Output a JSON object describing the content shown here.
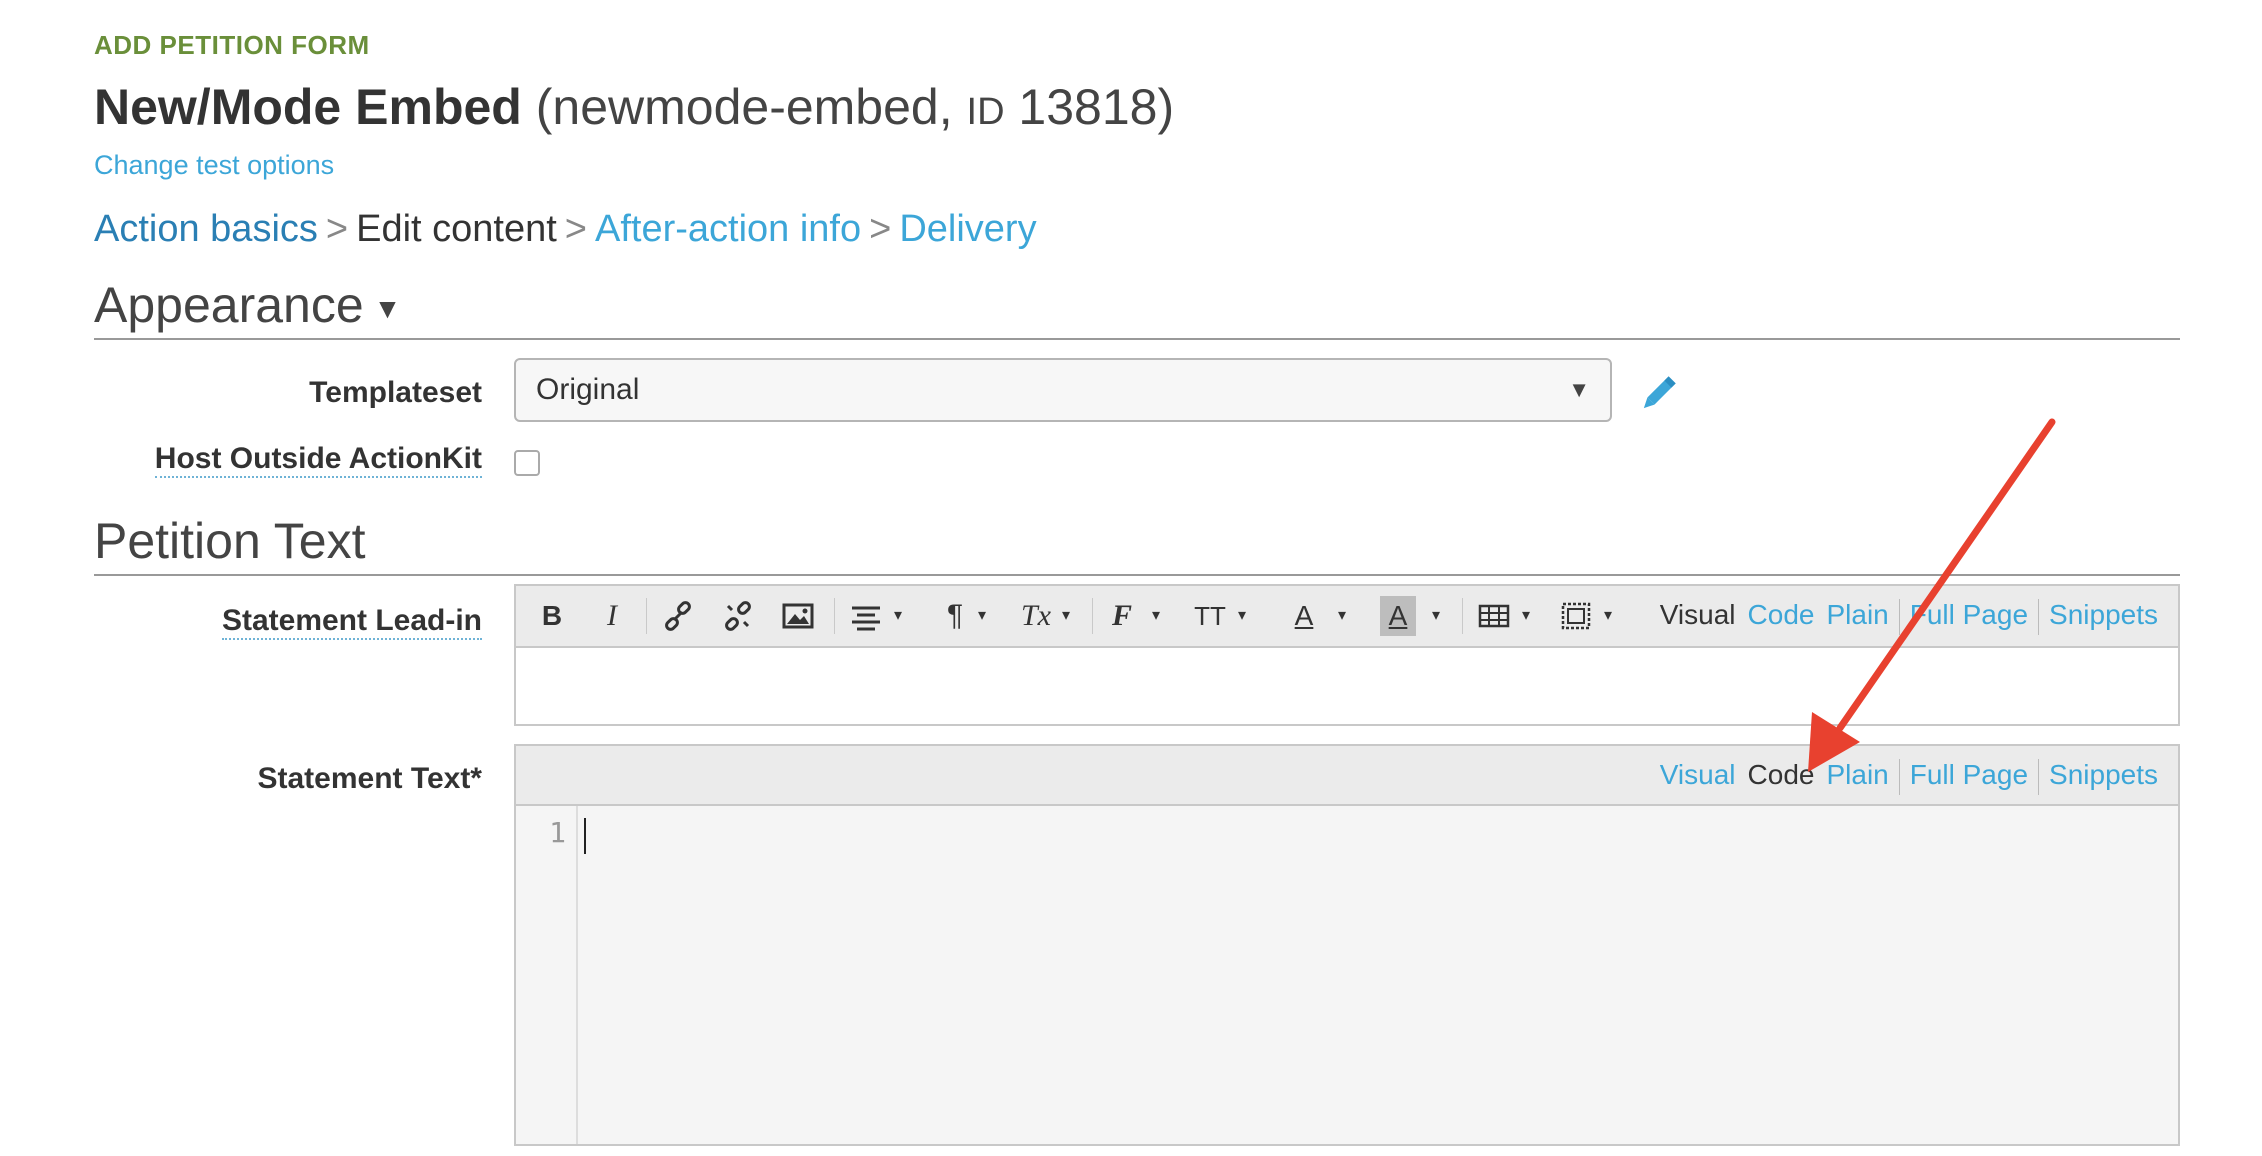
{
  "header": {
    "kicker": "ADD PETITION FORM",
    "title_name": "New/Mode Embed",
    "title_slug_open": "(newmode-embed, ",
    "title_id_label": "ID",
    "title_id_value": " 13818)",
    "change_link": "Change test options"
  },
  "breadcrumb": {
    "items": [
      "Action basics",
      "Edit content",
      "After-action info",
      "Delivery"
    ],
    "separator": ">"
  },
  "sections": {
    "appearance": "Appearance",
    "appearance_caret": "▼",
    "petition_text": "Petition Text"
  },
  "fields": {
    "templateset_label": "Templateset",
    "templateset_value": "Original",
    "host_outside_label": "Host Outside ActionKit",
    "statement_leadin_label": "Statement Lead-in",
    "statement_text_label": "Statement Text*"
  },
  "toolbar": {
    "bold": "B",
    "italic": "I",
    "paragraph": "¶",
    "clear_format": "Tx",
    "font": "F",
    "size": "TT",
    "text_color": "A",
    "bg_color": "A",
    "dropdown": "▾"
  },
  "modes": {
    "visual": "Visual",
    "code": "Code",
    "plain": "Plain",
    "full_page": "Full Page",
    "snippets": "Snippets"
  },
  "code_editor": {
    "line_number": "1"
  },
  "colors": {
    "kicker_green": "#6a8f3a",
    "link_blue": "#3ca6d8",
    "annotation_red": "#e8412f"
  }
}
